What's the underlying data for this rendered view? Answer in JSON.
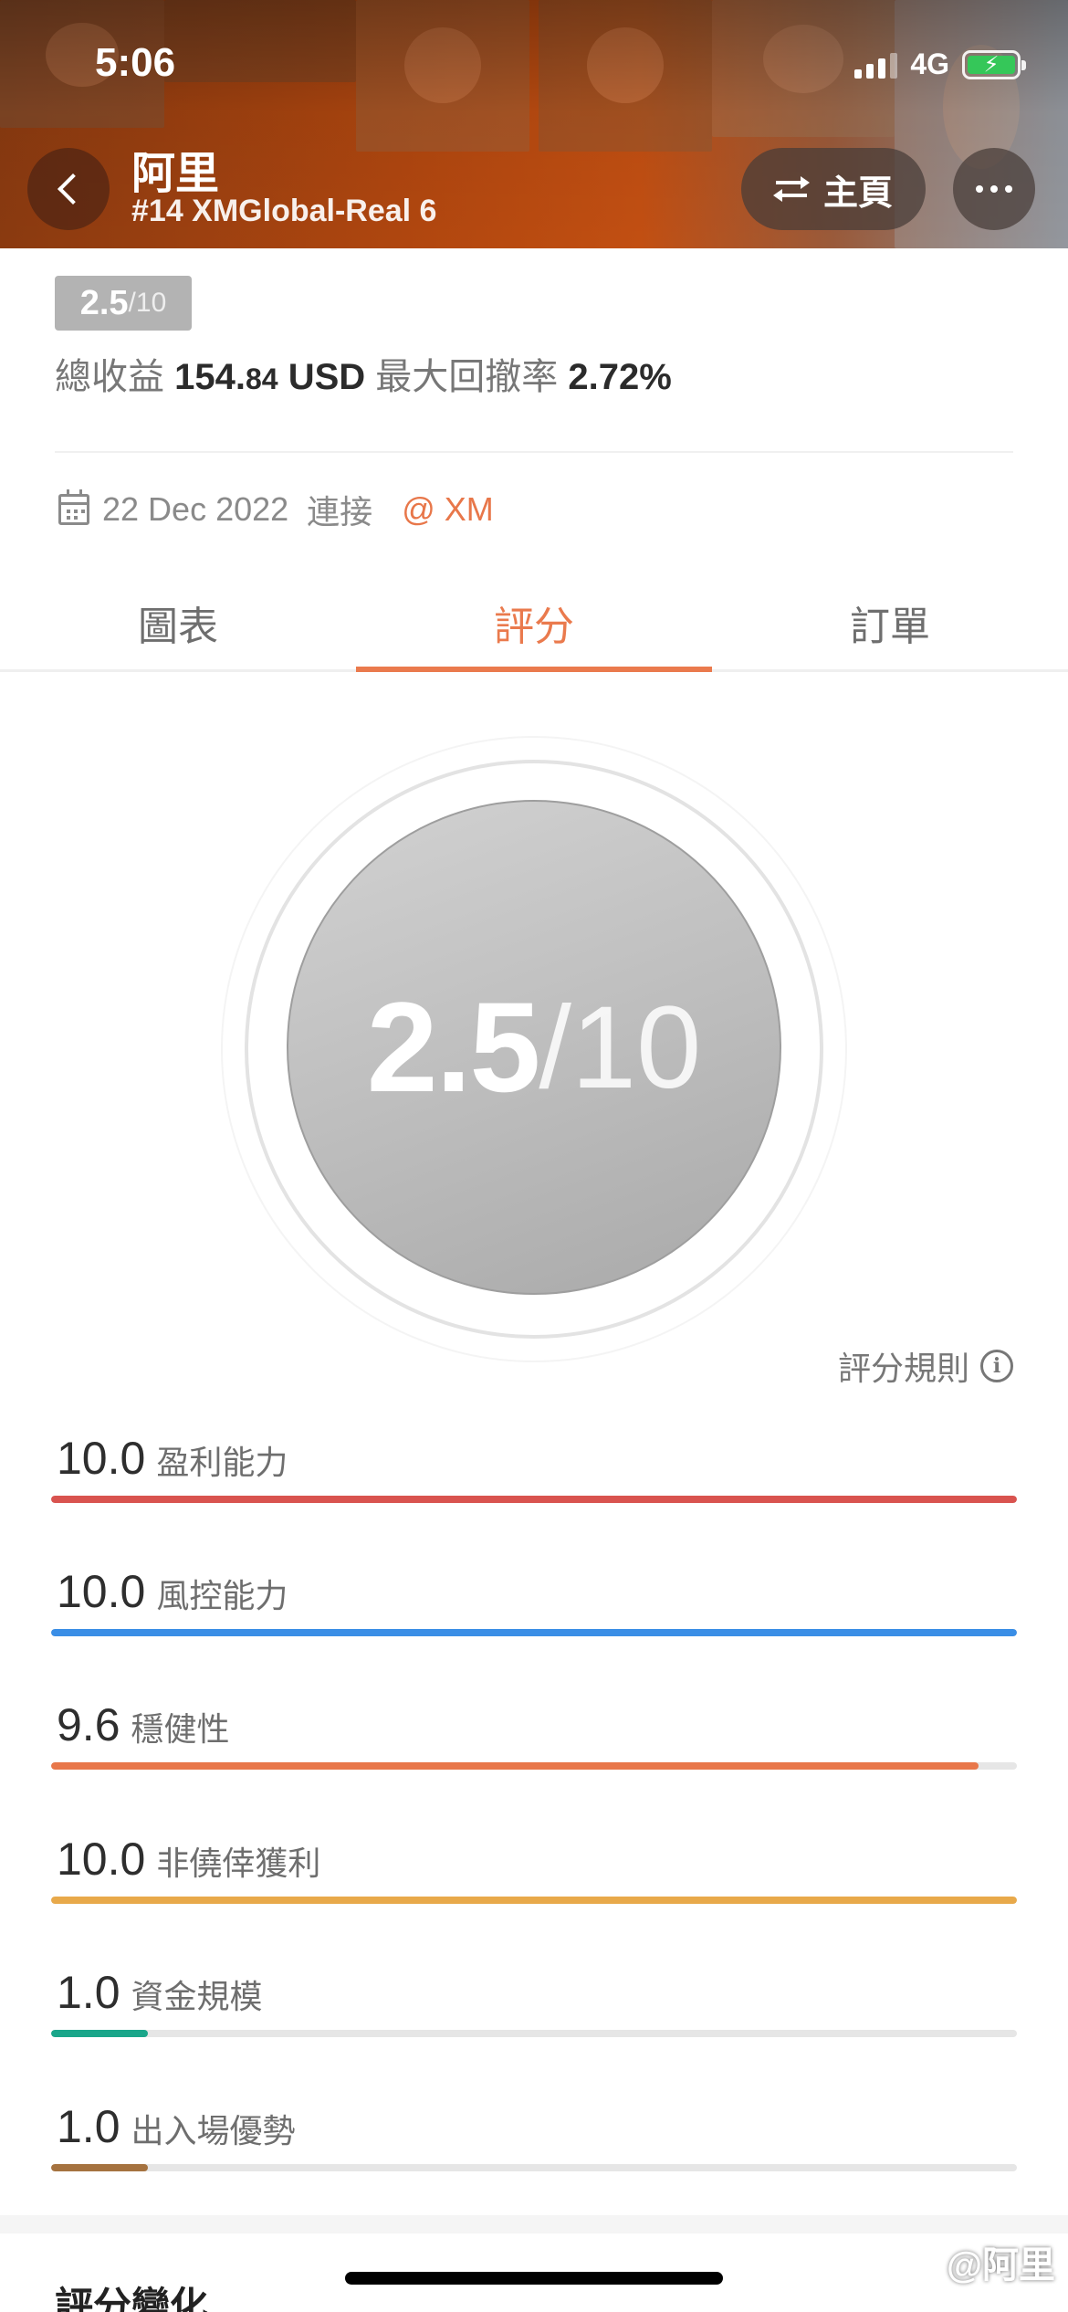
{
  "status_bar": {
    "time": "5:06",
    "network": "4G"
  },
  "header": {
    "trader_name": "阿里",
    "trader_subtitle": "#14 XMGlobal-Real 6",
    "home_label": "主頁"
  },
  "summary": {
    "score": "2.5",
    "score_max": "/10",
    "total_profit_label": "總收益",
    "total_profit_int": "154.",
    "total_profit_dec": "84",
    "total_profit_unit": "USD",
    "max_drawdown_label": "最大回撤率",
    "max_drawdown_value": "2.72%",
    "connected_date": "22 Dec 2022",
    "connected_label": "連接",
    "broker": "@ XM"
  },
  "tabs": [
    {
      "label": "圖表",
      "active": false
    },
    {
      "label": "評分",
      "active": true
    },
    {
      "label": "訂單",
      "active": false
    }
  ],
  "dial": {
    "score": "2.5",
    "max": "/10"
  },
  "rules_label": "評分規則",
  "metrics": [
    {
      "value": "10.0",
      "label": "盈利能力",
      "fraction": 1.0,
      "color": "#d9534f"
    },
    {
      "value": "10.0",
      "label": "風控能力",
      "fraction": 1.0,
      "color": "#3a8ee6"
    },
    {
      "value": "9.6",
      "label": "穩健性",
      "fraction": 0.96,
      "color": "#e8774a"
    },
    {
      "value": "10.0",
      "label": "非僥倖獲利",
      "fraction": 1.0,
      "color": "#e8a94a"
    },
    {
      "value": "1.0",
      "label": "資金規模",
      "fraction": 0.1,
      "color": "#1aa68a"
    },
    {
      "value": "1.0",
      "label": "出入場優勢",
      "fraction": 0.1,
      "color": "#a5723f"
    }
  ],
  "bottom": {
    "section_title": "評分變化",
    "watermark": "@阿里"
  },
  "colors": {
    "accent": "#ea7a4d",
    "score_gray": "#b3b3b3"
  },
  "icons": [
    "back-chevron-icon",
    "swap-icon",
    "more-icon",
    "calendar-icon",
    "info-icon",
    "battery-icon",
    "signal-icon"
  ]
}
